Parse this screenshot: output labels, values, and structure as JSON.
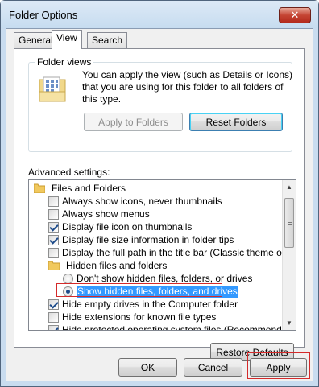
{
  "window": {
    "title": "Folder Options",
    "close_glyph": "✕"
  },
  "tabs": [
    {
      "label": "General"
    },
    {
      "label": "View"
    },
    {
      "label": "Search"
    }
  ],
  "folder_views": {
    "label": "Folder views",
    "description": "You can apply the view (such as Details or Icons) that you are using for this folder to all folders of this type.",
    "apply_button": "Apply to Folders",
    "reset_button": "Reset Folders"
  },
  "advanced": {
    "label": "Advanced settings:",
    "items": [
      {
        "kind": "folder",
        "label": "Files and Folders"
      },
      {
        "kind": "checkbox",
        "checked": false,
        "label": "Always show icons, never thumbnails"
      },
      {
        "kind": "checkbox",
        "checked": false,
        "label": "Always show menus"
      },
      {
        "kind": "checkbox",
        "checked": true,
        "label": "Display file icon on thumbnails"
      },
      {
        "kind": "checkbox",
        "checked": true,
        "label": "Display file size information in folder tips"
      },
      {
        "kind": "checkbox",
        "checked": false,
        "label": "Display the full path in the title bar (Classic theme only)"
      },
      {
        "kind": "folder",
        "label": "Hidden files and folders"
      },
      {
        "kind": "radio",
        "checked": false,
        "label": "Don't show hidden files, folders, or drives"
      },
      {
        "kind": "radio",
        "checked": true,
        "label": "Show hidden files, folders, and drives"
      },
      {
        "kind": "checkbox",
        "checked": true,
        "label": "Hide empty drives in the Computer folder"
      },
      {
        "kind": "checkbox",
        "checked": false,
        "label": "Hide extensions for known file types"
      },
      {
        "kind": "checkbox",
        "checked": true,
        "label": "Hide protected operating system files (Recommended)"
      }
    ],
    "restore_button": "Restore Defaults"
  },
  "footer": {
    "ok": "OK",
    "cancel": "Cancel",
    "apply": "Apply"
  },
  "colors": {
    "highlight": "#3399ff",
    "annotation_red": "#d42a2a",
    "window_frame": "#c9dcef"
  }
}
